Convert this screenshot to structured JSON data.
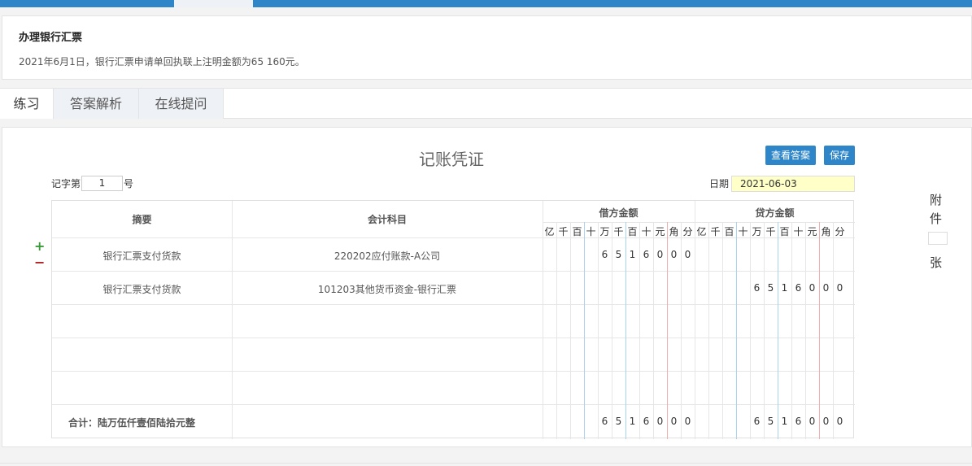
{
  "task": {
    "title": "办理银行汇票",
    "desc": "2021年6月1日，银行汇票申请单回执联上注明金额为65 160元。"
  },
  "tabs": [
    "练习",
    "答案解析",
    "在线提问"
  ],
  "voucher": {
    "title": "记账凭证",
    "view_answer_label": "查看答案",
    "save_label": "保存",
    "num_prefix": "记字第",
    "num_value": "1",
    "num_suffix": "号",
    "date_label": "日期",
    "date_value": "2021-06-03",
    "col_summary": "摘要",
    "col_account": "会计科目",
    "col_debit": "借方金额",
    "col_credit": "贷方金额",
    "units": [
      "亿",
      "千",
      "百",
      "十",
      "万",
      "千",
      "百",
      "十",
      "元",
      "角",
      "分"
    ],
    "rows": [
      {
        "summary": "银行汇票支付货款",
        "account": "220202应付账款-A公司",
        "debit": [
          "",
          "",
          "",
          "",
          "6",
          "5",
          "1",
          "6",
          "0",
          "0",
          "0"
        ],
        "credit": [
          "",
          "",
          "",
          "",
          "",
          "",
          "",
          "",
          "",
          "",
          ""
        ]
      },
      {
        "summary": "银行汇票支付货款",
        "account": "101203其他货币资金-银行汇票",
        "debit": [
          "",
          "",
          "",
          "",
          "",
          "",
          "",
          "",
          "",
          "",
          ""
        ],
        "credit": [
          "",
          "",
          "",
          "",
          "6",
          "5",
          "1",
          "6",
          "0",
          "0",
          "0"
        ]
      }
    ],
    "total_label": "合计：陆万伍仟壹佰陆拾元整",
    "total_debit": [
      "",
      "",
      "",
      "",
      "6",
      "5",
      "1",
      "6",
      "0",
      "0",
      "0"
    ],
    "total_credit": [
      "",
      "",
      "",
      "",
      "6",
      "5",
      "1",
      "6",
      "0",
      "0",
      "0"
    ],
    "add_row": "+",
    "remove_row": "−",
    "attach_1": "附",
    "attach_2": "件",
    "attach_3": "张"
  },
  "colors": {
    "accent": "#2e86c9",
    "plus": "#3a9a3a",
    "minus": "#b02020",
    "date_bg": "#ffffc8"
  }
}
